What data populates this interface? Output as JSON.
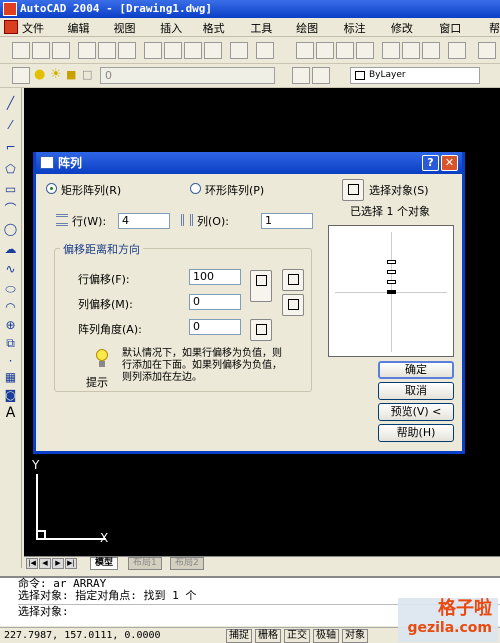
{
  "app": {
    "title": "AutoCAD 2004 - [Drawing1.dwg]"
  },
  "menu": [
    "文件(F)",
    "编辑(E)",
    "视图(V)",
    "插入(I)",
    "格式(O)",
    "工具(T)",
    "绘图(D)",
    "标注(N)",
    "修改(M)",
    "窗口(W)",
    "帮"
  ],
  "layer": {
    "current": "0",
    "linetype": "ByLayer"
  },
  "dialog": {
    "title": "阵列",
    "rect_label": "矩形阵列(R)",
    "polar_label": "环形阵列(P)",
    "rows_label": "行(W):",
    "rows_value": "4",
    "cols_label": "列(O):",
    "cols_value": "1",
    "offset_group": "偏移距离和方向",
    "row_offset_label": "行偏移(F):",
    "row_offset_value": "100",
    "col_offset_label": "列偏移(M):",
    "col_offset_value": "0",
    "angle_label": "阵列角度(A):",
    "angle_value": "0",
    "tip_label": "提示",
    "tip_text_1": "默认情况下，如果行偏移为负值，则",
    "tip_text_2": "行添加在下面。如果列偏移为负值，",
    "tip_text_3": "则列添加在左边。",
    "select_label": "选择对象(S)",
    "selected_text": "已选择 1 个对象",
    "ok": "确定",
    "cancel": "取消",
    "preview": "预览(V) <",
    "help": "帮助(H)",
    "preview_cells": 4
  },
  "ucs": {
    "y": "Y",
    "x": "X"
  },
  "tabs": [
    "模型",
    "布局1",
    "布局2"
  ],
  "command": {
    "line1": "命令: ar ARRAY",
    "line2": "选择对象: 指定对角点: 找到 1 个",
    "line3": "选择对象:"
  },
  "status": {
    "coords": "227.7987, 157.0111, 0.0000",
    "buttons": [
      "捕捉",
      "栅格",
      "正交",
      "极轴",
      "对象"
    ]
  },
  "watermark": {
    "big": "格子啦",
    "small": "gezila.com"
  }
}
